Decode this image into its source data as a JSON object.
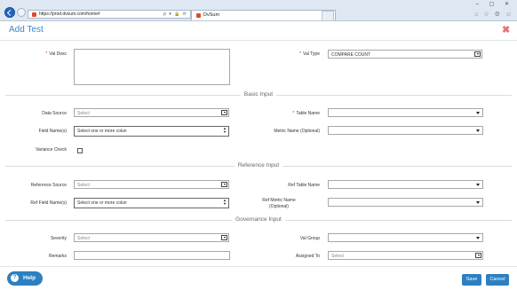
{
  "browser": {
    "url": "https://prod.dvsum.com/home#",
    "tab_title": "DvSum",
    "tab_close": "×",
    "address_tools": "ρ ▾ 🔒 ⟳",
    "window_controls": "–  ▢  ✕",
    "icons": [
      "home-icon",
      "star-icon",
      "gear-icon",
      "smiley-icon"
    ],
    "icon_glyphs": "⌂ ☆ ⚙ ☺"
  },
  "modal": {
    "title": "Add Test",
    "close_glyph": "✖",
    "required_marker": "*"
  },
  "top": {
    "val_desc_label": "Val Desc",
    "val_type_label": "Val Type",
    "val_type_value": "COMPARE COUNT"
  },
  "sections": {
    "basic": "Basic Input",
    "reference": "Reference Input",
    "governance": "Governance Input"
  },
  "basic": {
    "data_source_label": "Data Source",
    "data_source_placeholder": "Select",
    "table_name_label": "Table Name",
    "field_names_label": "Field Name(s)",
    "field_names_placeholder": "Select one or more colun",
    "metric_name_label": "Metric Name (Optional)",
    "variance_check_label": "Variance Check"
  },
  "reference": {
    "ref_source_label": "Reference Source",
    "ref_source_placeholder": "Select",
    "ref_table_label": "Ref Table Name",
    "ref_field_label": "Ref Field Name(s)",
    "ref_field_placeholder": "Select one or more colun",
    "ref_metric_label_1": "Ref Metric Name",
    "ref_metric_label_2": "(Optional)"
  },
  "governance": {
    "severity_label": "Severity",
    "severity_placeholder": "Select",
    "val_group_label": "Val Group",
    "remarks_label": "Remarks",
    "assigned_to_label": "Assigned To",
    "assigned_to_placeholder": "Select"
  },
  "footer": {
    "help_label": "Help",
    "help_glyph": "?",
    "save_label": "Save",
    "cancel_label": "Cancel"
  },
  "colors": {
    "accent": "#3d85c6",
    "button": "#2d7fc1",
    "required": "#d32f2f",
    "close": "#e57373"
  }
}
